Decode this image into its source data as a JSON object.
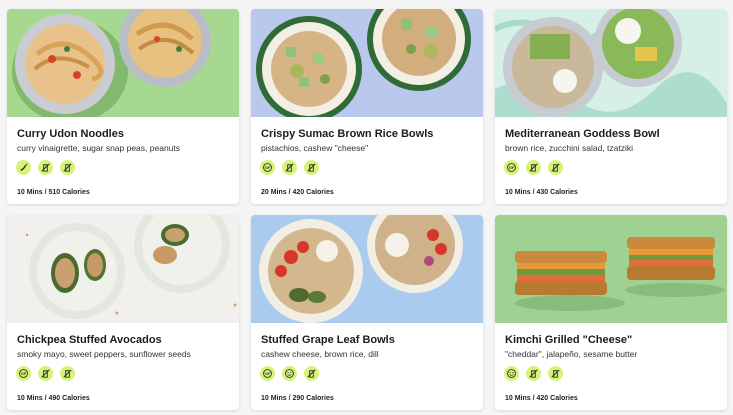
{
  "colors": {
    "tag_bg": "#d9f07a",
    "tag_fg": "#1d3a1f"
  },
  "cards": [
    {
      "title": "Curry Udon Noodles",
      "subtitle": "curry vinaigrette, sugar snap peas, peanuts",
      "meta": "10 Mins / 510 Calories",
      "tags": [
        "chili-pepper-icon",
        "no-dairy-icon",
        "no-dairy-icon"
      ]
    },
    {
      "title": "Crispy Sumac Brown Rice Bowls",
      "subtitle": "pistachios, cashew \"cheese\"",
      "meta": "20 Mins / 420 Calories",
      "tags": [
        "gluten-free-icon",
        "no-dairy-icon",
        "no-dairy-icon"
      ]
    },
    {
      "title": "Mediterranean Goddess Bowl",
      "subtitle": "brown rice, zucchini salad, tzatziki",
      "meta": "10 Mins / 430 Calories",
      "tags": [
        "gluten-free-icon",
        "no-dairy-icon",
        "no-dairy-icon"
      ]
    },
    {
      "title": "Chickpea Stuffed Avocados",
      "subtitle": "smoky mayo, sweet peppers, sunflower seeds",
      "meta": "10 Mins / 490 Calories",
      "tags": [
        "gluten-free-icon",
        "no-dairy-icon",
        "no-dairy-icon"
      ]
    },
    {
      "title": "Stuffed Grape Leaf Bowls",
      "subtitle": "cashew cheese, brown rice, dill",
      "meta": "10 Mins / 290 Calories",
      "tags": [
        "gluten-free-icon",
        "smile-icon",
        "no-dairy-icon"
      ]
    },
    {
      "title": "Kimchi Grilled \"Cheese\"",
      "subtitle": "\"cheddar\", jalapeño, sesame butter",
      "meta": "10 Mins / 420 Calories",
      "tags": [
        "smile-icon",
        "no-dairy-icon",
        "no-dairy-icon"
      ]
    }
  ]
}
